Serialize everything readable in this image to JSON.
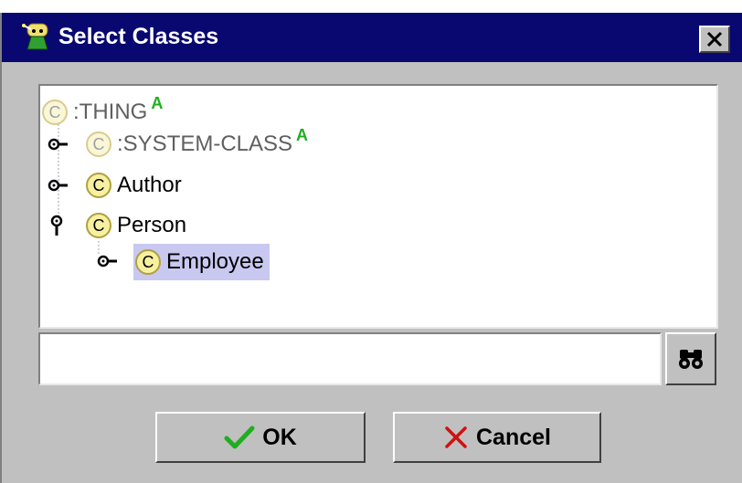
{
  "dialog": {
    "title": "Select Classes",
    "title_icon": "wizard-icon",
    "close_icon": "close-icon"
  },
  "tree": {
    "nodes": [
      {
        "label": ":THING",
        "icon_text": "C",
        "abstract_marker": "A",
        "style": "system",
        "expander": "none"
      },
      {
        "label": ":SYSTEM-CLASS",
        "icon_text": "C",
        "abstract_marker": "A",
        "style": "system",
        "expander": "collapsed"
      },
      {
        "label": "Author",
        "icon_text": "C",
        "abstract_marker": "",
        "style": "normal",
        "expander": "collapsed"
      },
      {
        "label": "Person",
        "icon_text": "C",
        "abstract_marker": "",
        "style": "normal",
        "expander": "expanded"
      },
      {
        "label": "Employee",
        "icon_text": "C",
        "abstract_marker": "",
        "style": "normal",
        "expander": "collapsed",
        "selected": true
      }
    ]
  },
  "search": {
    "value": "",
    "placeholder": "",
    "button_icon": "binoculars-icon"
  },
  "buttons": {
    "ok_label": "OK",
    "ok_icon": "checkmark-icon",
    "cancel_label": "Cancel",
    "cancel_icon": "x-icon"
  },
  "colors": {
    "title_bar": "#080870",
    "dialog_bg": "#c0c0c0",
    "selection": "#c8c8f0",
    "abstract_marker": "#1fae1f",
    "ok_check": "#1fae1f",
    "cancel_x": "#d01010"
  }
}
